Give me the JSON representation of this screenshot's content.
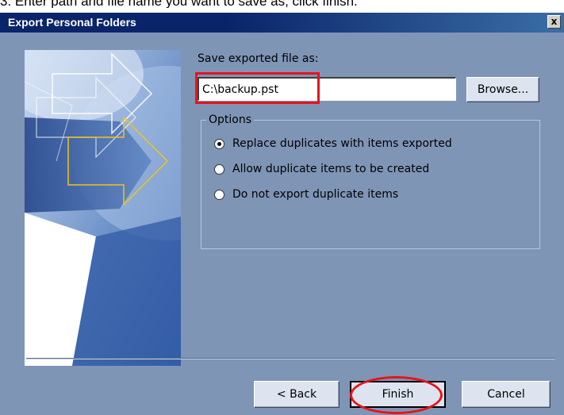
{
  "instruction": "3. Enter path and file name you want to save as, click finish.",
  "window": {
    "title": "Export Personal Folders",
    "close_glyph": "x"
  },
  "form": {
    "save_label": "Save exported file as:",
    "path_value": "C:\\backup.pst",
    "browse_label": "Browse..."
  },
  "options": {
    "legend": "Options",
    "items": [
      {
        "label": "Replace duplicates with items exported",
        "checked": true
      },
      {
        "label": "Allow duplicate items to be created",
        "checked": false
      },
      {
        "label": "Do not export duplicate items",
        "checked": false
      }
    ]
  },
  "buttons": {
    "back": "< Back",
    "finish": "Finish",
    "cancel": "Cancel"
  },
  "colors": {
    "dialog_bg": "#7f95b6",
    "highlight": "#e8131a",
    "titlebar": "#0a246a"
  },
  "icons": [
    "close-icon",
    "wizard-arrow-illustration",
    "radio-selected-icon",
    "radio-empty-icon"
  ]
}
